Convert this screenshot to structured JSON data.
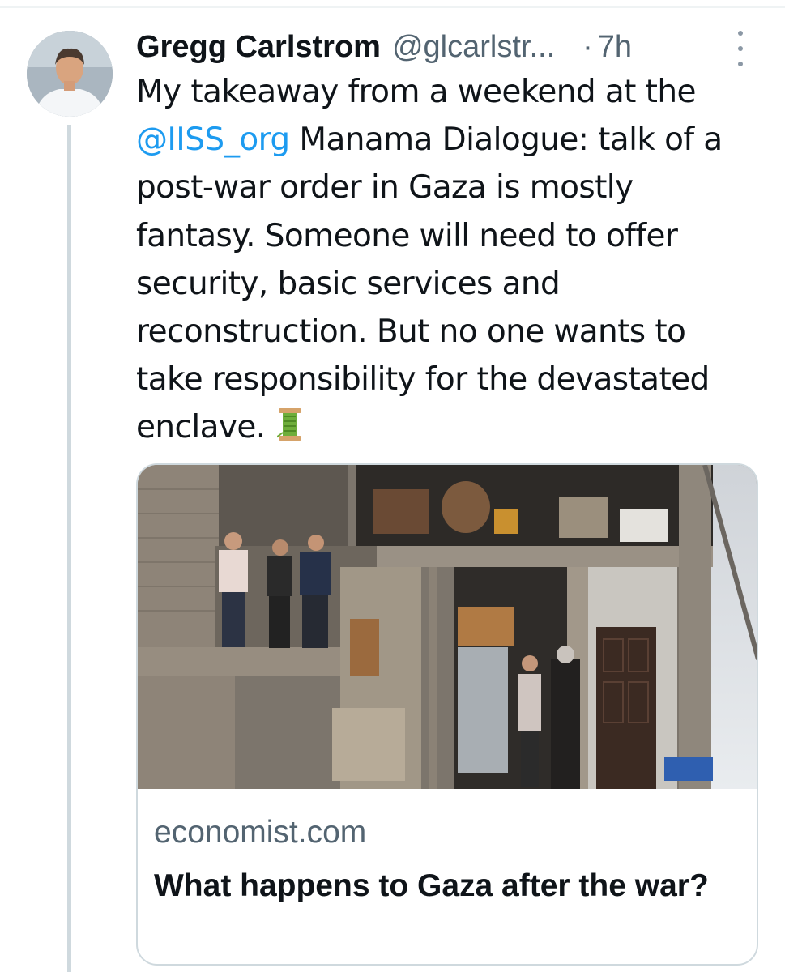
{
  "tweet": {
    "author_name": "Gregg Carlstrom",
    "author_handle": "@glcarlstr...",
    "separator": "·",
    "timestamp": "7h",
    "avatar_icon": "author-avatar",
    "more_icon": "more-vertical-icon",
    "text_lines": [
      [
        "My takeaway from a weekend at the"
      ],
      [
        "@IISS_org",
        " Manama Dialogue: talk of a"
      ],
      [
        "post-war order in Gaza is mostly"
      ],
      [
        "fantasy. Someone will need to offer"
      ],
      [
        "security, basic services and"
      ],
      [
        "reconstruction. But no one wants to"
      ],
      [
        "take responsibility for the devastated"
      ],
      [
        "enclave."
      ]
    ],
    "mention": "@IISS_org",
    "emoji": "spool-of-thread-emoji"
  },
  "link_card": {
    "domain": "economist.com",
    "title": "What happens to Gaza after the war?"
  },
  "colors": {
    "link": "#1d9bf0",
    "muted": "#536471",
    "text": "#0f1419",
    "border": "#cfd9de"
  }
}
